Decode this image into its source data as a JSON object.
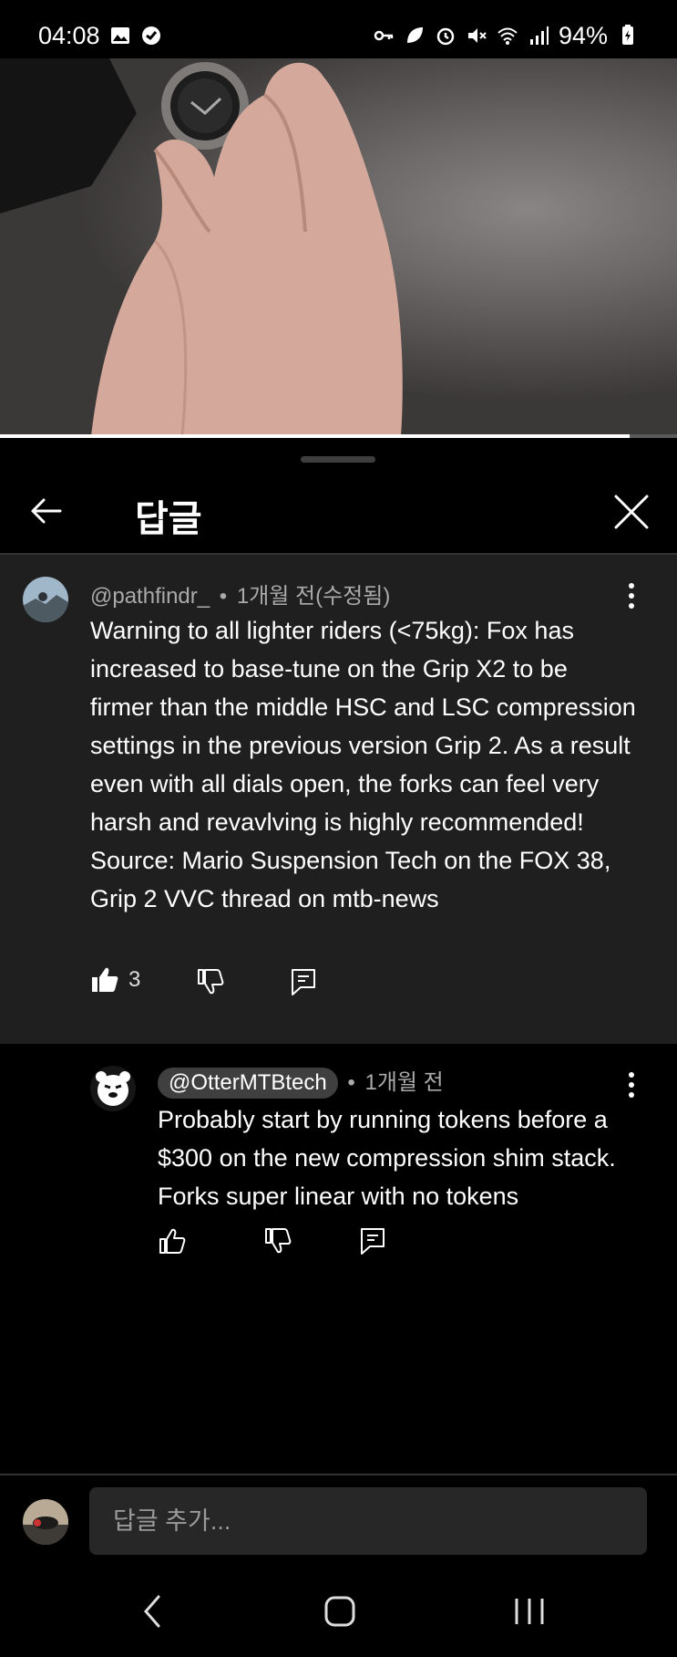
{
  "status_bar": {
    "time": "04:08",
    "battery": "94%"
  },
  "video": {
    "progress_fraction": 0.93
  },
  "sheet": {
    "title": "답글"
  },
  "parent_comment": {
    "author": "@pathfindr_",
    "separator": "•",
    "timestamp": "1개월 전(수정됨)",
    "text": "Warning to all lighter riders (<75kg): Fox has increased to base-tune on the Grip X2 to be firmer than the middle HSC and LSC compression settings in the previous version Grip 2. As a result even with all dials open, the forks can feel very harsh and revavlving is highly recommended! Source: Mario Suspension Tech on the FOX 38, Grip 2 VVC thread on mtb-news",
    "like_count": "3"
  },
  "reply_comment": {
    "author": "@OtterMTBtech",
    "separator": "•",
    "timestamp": "1개월 전",
    "text": "Probably start by running tokens before a $300 on the new compression shim stack. Forks super linear with no tokens"
  },
  "reply_input": {
    "placeholder": "답글 추가..."
  },
  "icons": {
    "status_left": [
      "gallery-icon",
      "sync-icon"
    ],
    "status_right": [
      "key-icon",
      "leaf-icon",
      "alarm-icon",
      "mute-icon",
      "wifi-icon",
      "signal-icon",
      "battery-icon"
    ]
  }
}
